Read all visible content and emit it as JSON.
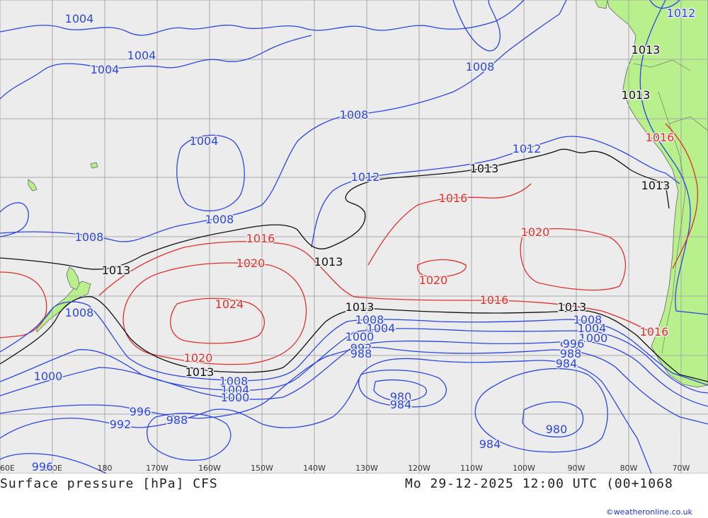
{
  "title_left": "Surface pressure [hPa] CFS",
  "title_right": "Mo 29-12-2025 12:00 UTC (00+1068",
  "credit": "©weatheronline.co.uk",
  "colors": {
    "ocean": "#ececec",
    "land": "#b8f08c",
    "grid": "#a9a9a9",
    "isobar_low": "#2c46e0",
    "isobar_ref": "#111111",
    "isobar_high": "#e0302a",
    "footer_text": "#222222",
    "credit": "#2233bb"
  },
  "longitude_ticks": [
    "60E",
    "170E",
    "180",
    "170W",
    "160W",
    "150W",
    "140W",
    "130W",
    "120W",
    "110W",
    "100W",
    "90W",
    "80W",
    "70W"
  ],
  "isobar_labels": [
    {
      "text": "1004",
      "kind": "low"
    },
    {
      "text": "1004",
      "kind": "low"
    },
    {
      "text": "1004",
      "kind": "low"
    },
    {
      "text": "1008",
      "kind": "low"
    },
    {
      "text": "1008",
      "kind": "low"
    },
    {
      "text": "1004",
      "kind": "low"
    },
    {
      "text": "1012",
      "kind": "low"
    },
    {
      "text": "1012",
      "kind": "low"
    },
    {
      "text": "1013",
      "kind": "ref"
    },
    {
      "text": "1013",
      "kind": "ref"
    },
    {
      "text": "1013",
      "kind": "ref"
    },
    {
      "text": "1013",
      "kind": "ref"
    },
    {
      "text": "1012",
      "kind": "low"
    },
    {
      "text": "1016",
      "kind": "high"
    },
    {
      "text": "1016",
      "kind": "high"
    },
    {
      "text": "1008",
      "kind": "low"
    },
    {
      "text": "1008",
      "kind": "low"
    },
    {
      "text": "1013",
      "kind": "ref"
    },
    {
      "text": "1013",
      "kind": "ref"
    },
    {
      "text": "1020",
      "kind": "high"
    },
    {
      "text": "1016",
      "kind": "high"
    },
    {
      "text": "1020",
      "kind": "high"
    },
    {
      "text": "1020",
      "kind": "high"
    },
    {
      "text": "1013",
      "kind": "ref"
    },
    {
      "text": "1016",
      "kind": "high"
    },
    {
      "text": "1024",
      "kind": "high"
    },
    {
      "text": "1008",
      "kind": "low"
    },
    {
      "text": "1013",
      "kind": "ref"
    },
    {
      "text": "1013",
      "kind": "ref"
    },
    {
      "text": "1008",
      "kind": "low"
    },
    {
      "text": "1004",
      "kind": "low"
    },
    {
      "text": "1000",
      "kind": "low"
    },
    {
      "text": "992",
      "kind": "low"
    },
    {
      "text": "988",
      "kind": "low"
    },
    {
      "text": "1008",
      "kind": "low"
    },
    {
      "text": "1004",
      "kind": "low"
    },
    {
      "text": "1000",
      "kind": "low"
    },
    {
      "text": "996",
      "kind": "low"
    },
    {
      "text": "992",
      "kind": "low"
    },
    {
      "text": "988",
      "kind": "low"
    },
    {
      "text": "984",
      "kind": "low"
    },
    {
      "text": "1016",
      "kind": "high"
    },
    {
      "text": "1020",
      "kind": "high"
    },
    {
      "text": "1013",
      "kind": "ref"
    },
    {
      "text": "1008",
      "kind": "low"
    },
    {
      "text": "1004",
      "kind": "low"
    },
    {
      "text": "1000",
      "kind": "low"
    },
    {
      "text": "1000",
      "kind": "low"
    },
    {
      "text": "996",
      "kind": "low"
    },
    {
      "text": "992",
      "kind": "low"
    },
    {
      "text": "988",
      "kind": "low"
    },
    {
      "text": "980",
      "kind": "low"
    },
    {
      "text": "984",
      "kind": "low"
    },
    {
      "text": "980",
      "kind": "low"
    },
    {
      "text": "984",
      "kind": "low"
    },
    {
      "text": "996",
      "kind": "low"
    }
  ]
}
